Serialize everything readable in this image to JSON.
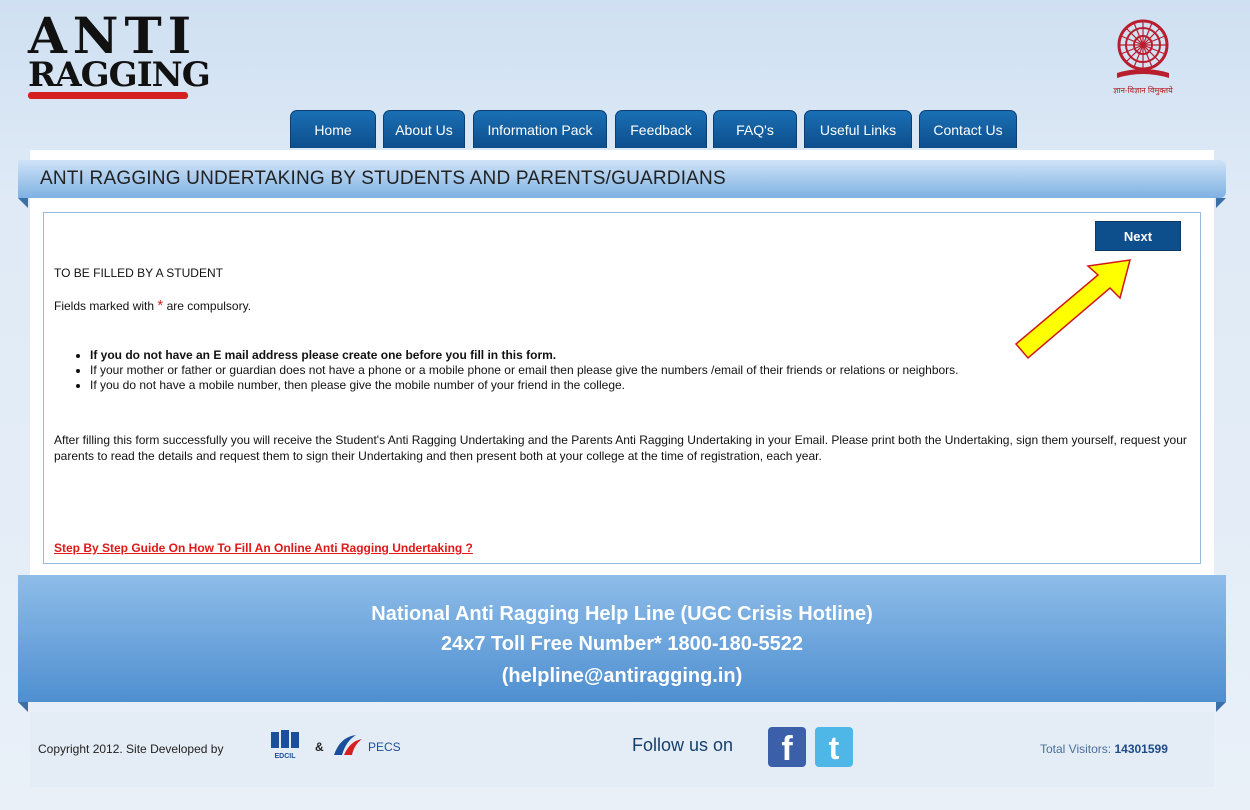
{
  "logo": {
    "line1": "ANTI",
    "line2": "RAGGING"
  },
  "emblem": {
    "caption": "ज्ञान-विज्ञान विमुक्तये"
  },
  "nav": {
    "items": [
      {
        "label": "Home"
      },
      {
        "label": "About Us"
      },
      {
        "label": "Information Pack"
      },
      {
        "label": "Feedback"
      },
      {
        "label": "FAQ's"
      },
      {
        "label": "Useful Links"
      },
      {
        "label": "Contact Us"
      }
    ]
  },
  "page": {
    "title": "ANTI RAGGING UNDERTAKING BY STUDENTS AND PARENTS/GUARDIANS",
    "next_label": "Next",
    "fill_heading": "TO BE FILLED BY A STUDENT",
    "fields_prefix": "Fields marked with",
    "star": "*",
    "fields_suffix": "are compulsory.",
    "bullets": [
      "If you do not have an E mail address please create one before you fill in this form.",
      "If your mother or father or guardian does not have a phone or a mobile phone or email then please give the numbers /email of their friends or relations or neighbors.",
      "If you do not have a mobile number, then please give the mobile number of your friend in the college."
    ],
    "paragraph": "After filling this form successfully you will receive the Student's Anti Ragging Undertaking and the Parents Anti Ragging Undertaking in your Email. Please print both the Undertaking, sign them yourself, request your parents to read the details and request them to sign their Undertaking and then present both at your college at the time of registration, each year.",
    "guide_link": "Step By Step Guide On How To Fill An Online Anti Ragging Undertaking ?"
  },
  "helpline": {
    "line1": "National Anti Ragging Help Line (UGC Crisis Hotline)",
    "line2": "24x7 Toll Free Number* 1800-180-5522",
    "line3": "(helpline@antiragging.in)"
  },
  "footer": {
    "copyright": "Copyright 2012. Site Developed by",
    "edcil": "EDCIL",
    "amp": "&",
    "pecs": "PECS",
    "follow": "Follow us on",
    "visitors_label": "Total Visitors:",
    "visitors_count": "14301599"
  },
  "colors": {
    "nav": "#0d4e8c",
    "accent_red": "#e01818",
    "arrow": "#ffff00"
  }
}
